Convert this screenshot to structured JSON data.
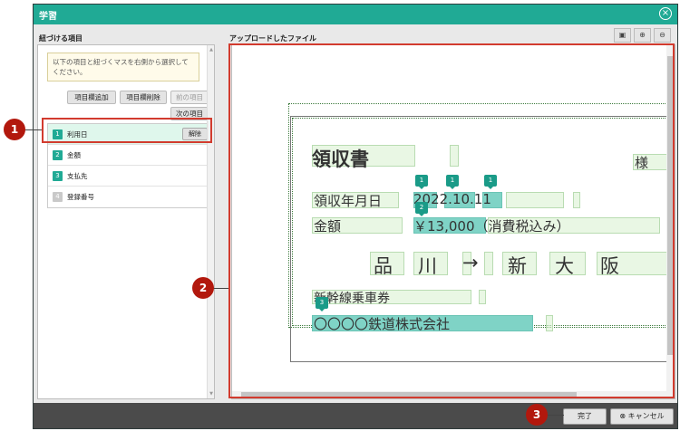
{
  "dialog": {
    "title": "学習",
    "close_icon": "×"
  },
  "left": {
    "label": "紐づける項目",
    "hint": "以下の項目と紐づくマスを右側から選択してください。",
    "buttons": {
      "add": "項目欄追加",
      "delete": "項目欄削除",
      "prev": "前の項目",
      "next": "次の項目"
    },
    "items": [
      {
        "num": "1",
        "label": "利用日",
        "unset": "解除"
      },
      {
        "num": "2",
        "label": "金額"
      },
      {
        "num": "3",
        "label": "支払先"
      },
      {
        "num": "4",
        "label": "登録番号"
      }
    ]
  },
  "right": {
    "label": "アップロードしたファイル",
    "tools": [
      "fit-icon",
      "zoom-in-icon",
      "zoom-out-icon"
    ]
  },
  "document": {
    "title": "領収書",
    "honorific": "様",
    "date_label": "領収年月日",
    "date_value": "2022.10.11",
    "amount_label": "金額",
    "amount_value": "￥13,000（消費税込み）",
    "route": [
      "品",
      "川",
      "→",
      "新",
      "大",
      "阪"
    ],
    "ticket": "新幹線乗車券",
    "company": "〇〇〇〇鉄道株式会社",
    "markers": [
      "1",
      "1",
      "1",
      "2",
      "3"
    ]
  },
  "footer": {
    "done": "完了",
    "cancel": "キャンセル"
  },
  "callouts": [
    "1",
    "2",
    "3"
  ],
  "colors": {
    "accent": "#20aa95",
    "callout": "#b2180d",
    "highlight": "#d23b2e"
  }
}
